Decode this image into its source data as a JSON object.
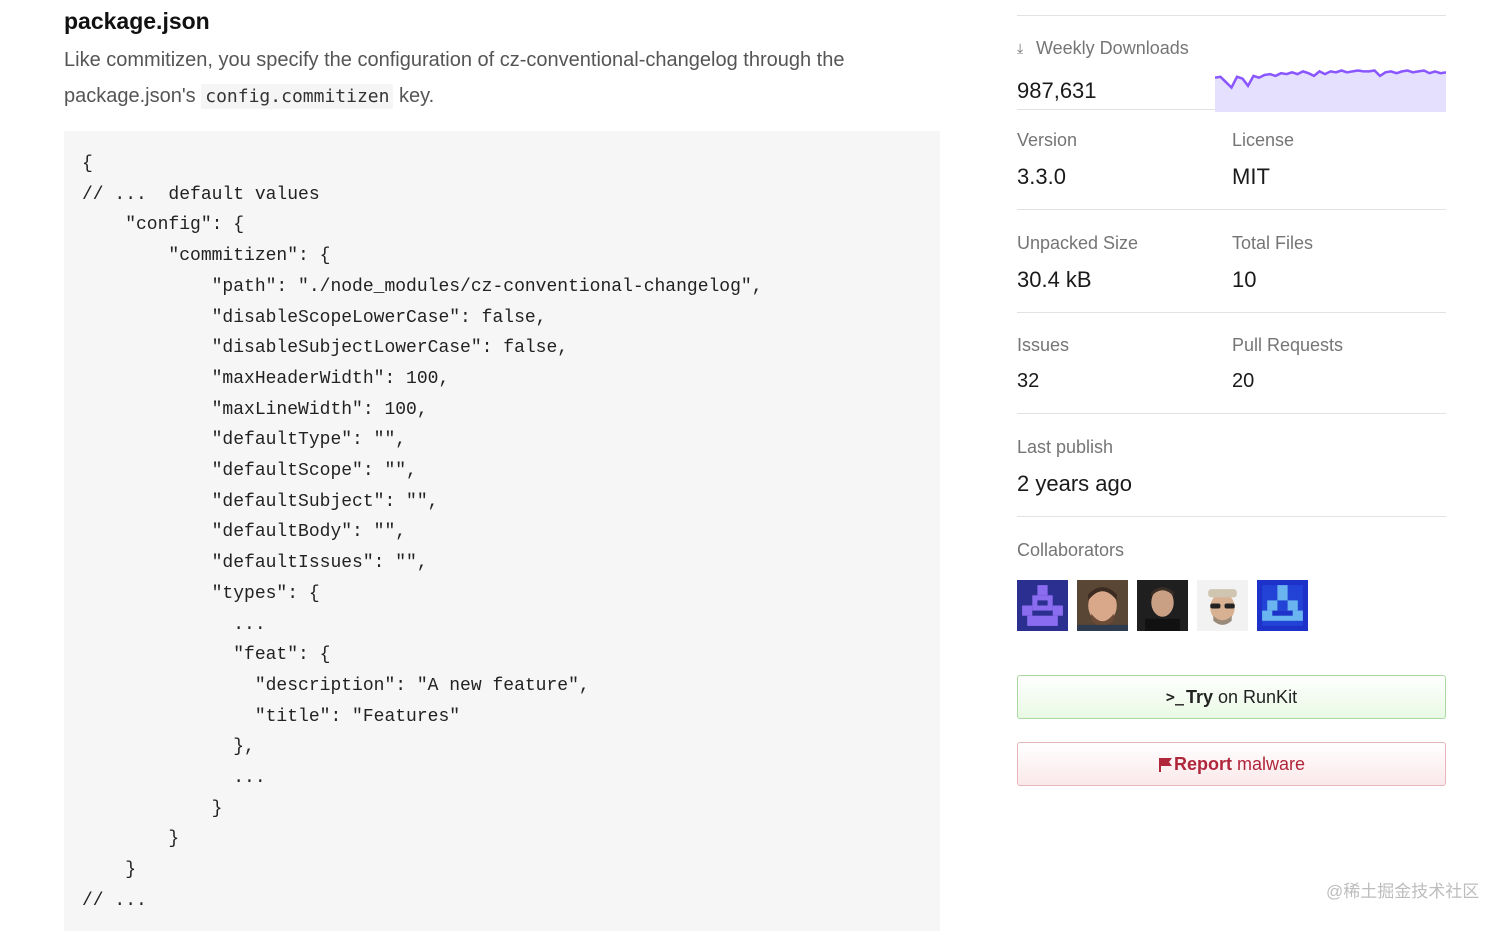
{
  "main": {
    "heading": "package.json",
    "para_before": "Like commitizen, you specify the configuration of cz-conventional-changelog through the package.json's",
    "para_code": "config.commitizen",
    "para_after": "key.",
    "code_lines": [
      "{",
      "// ...  default values",
      "    \"config\": {",
      "        \"commitizen\": {",
      "            \"path\": \"./node_modules/cz-conventional-changelog\",",
      "            \"disableScopeLowerCase\": false,",
      "            \"disableSubjectLowerCase\": false,",
      "            \"maxHeaderWidth\": 100,",
      "            \"maxLineWidth\": 100,",
      "            \"defaultType\": \"\",",
      "            \"defaultScope\": \"\",",
      "            \"defaultSubject\": \"\",",
      "            \"defaultBody\": \"\",",
      "            \"defaultIssues\": \"\",",
      "            \"types\": {",
      "              ...",
      "              \"feat\": {",
      "                \"description\": \"A new feature\",",
      "                \"title\": \"Features\"",
      "              },",
      "              ...",
      "            }",
      "        }",
      "    }",
      "// ..."
    ]
  },
  "sidebar": {
    "weekly_downloads_label": "Weekly Downloads",
    "weekly_downloads_value": "987,631",
    "download_icon": "download-icon",
    "sparkline_color": "#8956ff",
    "sparkline_fill": "#e6e0ff",
    "version_label": "Version",
    "version_value": "3.3.0",
    "license_label": "License",
    "license_value": "MIT",
    "unpacked_size_label": "Unpacked Size",
    "unpacked_size_value": "30.4 kB",
    "total_files_label": "Total Files",
    "total_files_value": "10",
    "issues_label": "Issues",
    "issues_value": "32",
    "pull_requests_label": "Pull Requests",
    "pull_requests_value": "20",
    "last_publish_label": "Last publish",
    "last_publish_value": "2 years ago",
    "collaborators_label": "Collaborators",
    "collaborators": [
      "avatar-identicon-purple",
      "avatar-photo-man",
      "avatar-photo-man-dark",
      "avatar-photo-sunglasses",
      "avatar-identicon-blue"
    ],
    "runkit_prefix": "Try",
    "runkit_suffix": "on RunKit",
    "report_prefix": "Report",
    "report_suffix": "malware"
  },
  "watermark": "@稀土掘金技术社区"
}
